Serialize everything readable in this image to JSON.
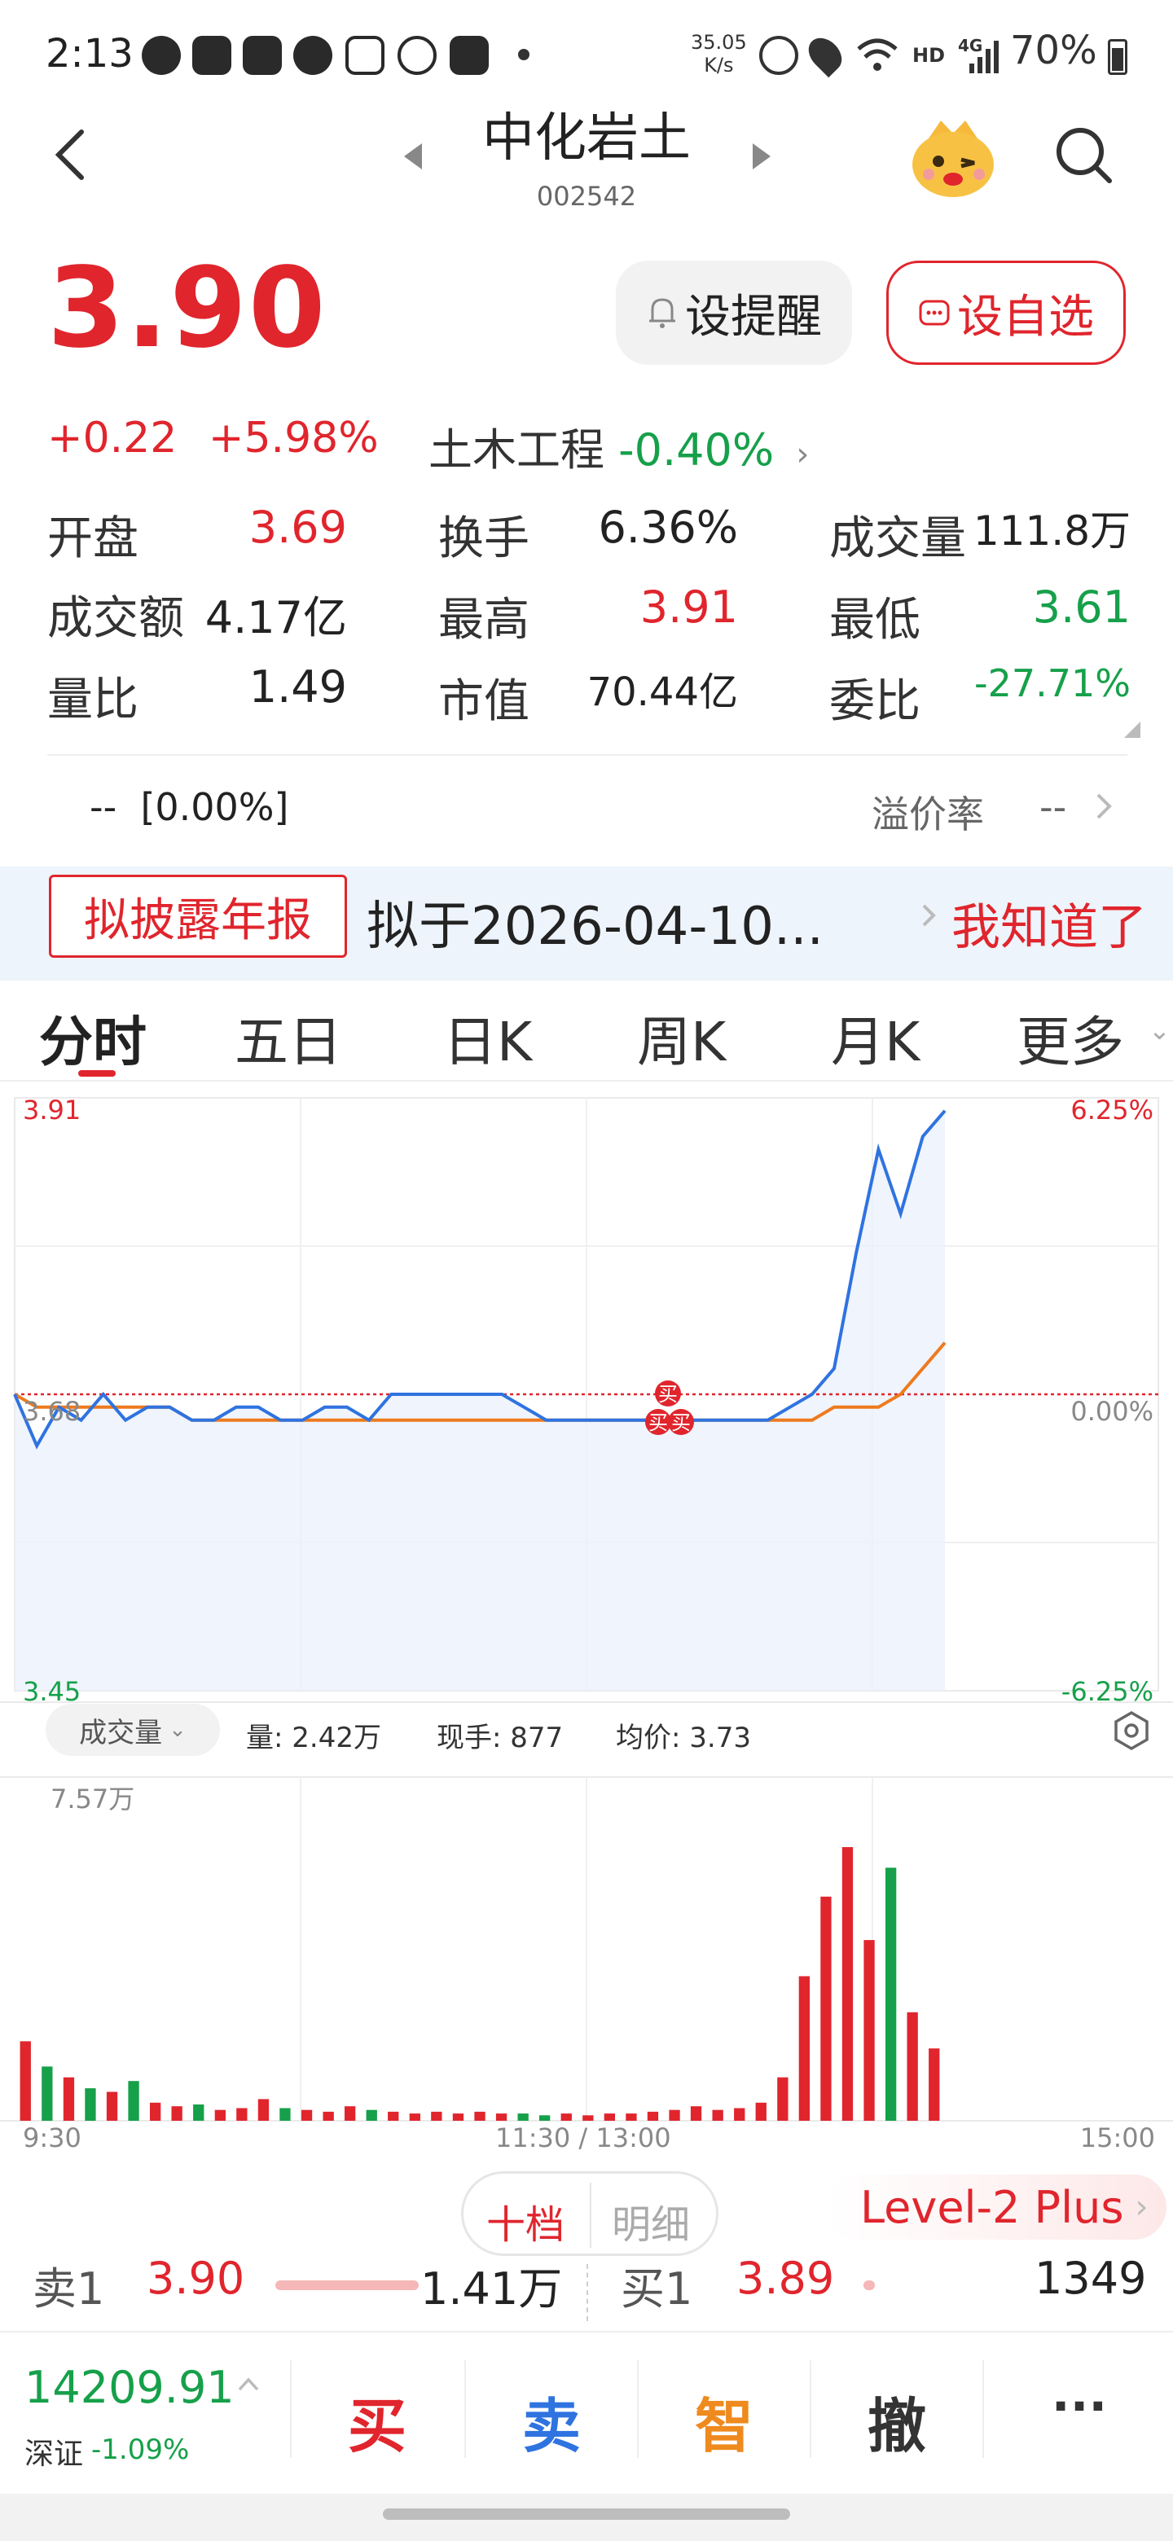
{
  "status_bar": {
    "time": "2:13",
    "net_speed_value": "35.05",
    "net_speed_unit": "K/s",
    "hd": "HD",
    "network": "4G",
    "battery": "70%"
  },
  "header": {
    "stock_name": "中化岩土",
    "stock_code": "002542"
  },
  "price": {
    "current": "3.90",
    "change": "+0.22",
    "change_pct": "+5.98%",
    "sector_name": "土木工程",
    "sector_change": "-0.40%"
  },
  "buttons": {
    "alert": "设提醒",
    "watchlist": "设自选"
  },
  "quote": {
    "open_label": "开盘",
    "open_value": "3.69",
    "turnover_label": "换手",
    "turnover_value": "6.36%",
    "volume_label": "成交量",
    "volume_value": "111.8万",
    "amount_label": "成交额",
    "amount_value": "4.17亿",
    "high_label": "最高",
    "high_value": "3.91",
    "low_label": "最低",
    "low_value": "3.61",
    "vol_ratio_label": "量比",
    "vol_ratio_value": "1.49",
    "mkt_cap_label": "市值",
    "mkt_cap_value": "70.44亿",
    "bid_ratio_label": "委比",
    "bid_ratio_value": "-27.71%"
  },
  "premium": {
    "left_text": "--  [0.00%]",
    "label": "溢价率",
    "value": "--"
  },
  "notice": {
    "tag": "拟披露年报",
    "text": "拟于2026-04-10...",
    "ack": "我知道了"
  },
  "tabs": [
    "分时",
    "五日",
    "日K",
    "周K",
    "月K",
    "更多"
  ],
  "chart": {
    "price_high": "3.91",
    "price_ref": "3.68",
    "price_low": "3.45",
    "pct_high": "6.25%",
    "pct_zero": "0.00%",
    "pct_low": "-6.25%",
    "buy_marker": "买",
    "indicator_select": "成交量",
    "vol_label": "量: 2.42万",
    "cur_hand_label": "现手: 877",
    "avg_price_label": "均价: 3.73",
    "vol_max": "7.57万",
    "time_start": "9:30",
    "time_mid": "11:30 / 13:00",
    "time_end": "15:00"
  },
  "chart_data": {
    "type": "line",
    "title": "",
    "x": [
      "9:30",
      "11:30 / 13:00",
      "15:00"
    ],
    "ylim": [
      3.45,
      3.91
    ],
    "reference_price": 3.68,
    "series": [
      {
        "name": "",
        "color": "#2f73e0",
        "values": [
          3.68,
          3.64,
          3.67,
          3.66,
          3.68,
          3.66,
          3.67,
          3.67,
          3.66,
          3.66,
          3.67,
          3.67,
          3.66,
          3.66,
          3.67,
          3.67,
          3.66,
          3.68,
          3.68,
          3.68,
          3.68,
          3.68,
          3.68,
          3.67,
          3.66,
          3.66,
          3.66,
          3.66,
          3.66,
          3.66,
          3.66,
          3.66,
          3.66,
          3.66,
          3.66,
          3.67,
          3.68,
          3.7,
          3.79,
          3.87,
          3.82,
          3.88,
          3.9
        ]
      },
      {
        "name": "",
        "color": "#ee7a1e",
        "values": [
          3.68,
          3.67,
          3.67,
          3.67,
          3.67,
          3.67,
          3.67,
          3.67,
          3.66,
          3.66,
          3.66,
          3.66,
          3.66,
          3.66,
          3.66,
          3.66,
          3.66,
          3.66,
          3.66,
          3.66,
          3.66,
          3.66,
          3.66,
          3.66,
          3.66,
          3.66,
          3.66,
          3.66,
          3.66,
          3.66,
          3.66,
          3.66,
          3.66,
          3.66,
          3.66,
          3.66,
          3.66,
          3.67,
          3.67,
          3.67,
          3.68,
          3.7,
          3.72
        ]
      }
    ],
    "volume_ymax": 75700,
    "volume_values": [
      22000,
      15000,
      12000,
      9000,
      8000,
      11000,
      5000,
      4000,
      4500,
      3000,
      3500,
      6000,
      3500,
      3000,
      2500,
      4000,
      3000,
      2500,
      2000,
      2500,
      2000,
      2500,
      2000,
      2000,
      1500,
      2000,
      1500,
      2000,
      2000,
      2500,
      3000,
      4000,
      3000,
      3500,
      5000,
      12000,
      40000,
      62000,
      75700,
      50000,
      70000,
      30000,
      20000
    ]
  },
  "orderbook": {
    "tab_ten": "十档",
    "tab_detail": "明细",
    "level2": "Level-2 Plus",
    "sell1_label": "卖1",
    "sell1_price": "3.90",
    "sell1_vol": "1.41万",
    "buy1_label": "买1",
    "buy1_price": "3.89",
    "buy1_vol": "1349"
  },
  "bottom_bar": {
    "index_value": "14209.91",
    "index_name": "深证",
    "index_change": "-1.09%",
    "buy": "买",
    "sell": "卖",
    "smart": "智",
    "cancel": "撤",
    "more": "···"
  },
  "colors": {
    "up": "#e0252d",
    "down": "#16a04a",
    "price_line": "#2f73e0",
    "avg_line": "#ee7a1e"
  }
}
